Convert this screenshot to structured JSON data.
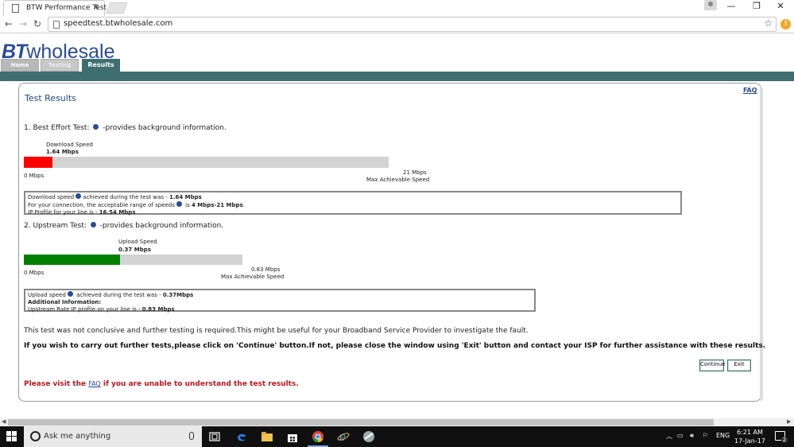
{
  "browser": {
    "tab_title": "BTW Performance Test",
    "tab_close": "✕",
    "url": "speedtest.btwholesale.com",
    "back": "←",
    "forward": "→",
    "reload": "↻",
    "star": "☆",
    "minimize": "—",
    "maximize": "❐",
    "close": "✕"
  },
  "header": {
    "logo_bt": "BT",
    "logo_wholesale": "wholesale",
    "tabs": [
      {
        "label": "Home"
      },
      {
        "label": "Testing"
      },
      {
        "label": "Results"
      }
    ]
  },
  "page": {
    "faq_link": "FAQ",
    "title": "Test Results",
    "best_effort": {
      "heading_prefix": "1. Best Effort Test:",
      "heading_suffix": "-provides background information.",
      "bar_label": "Download  Speed",
      "bar_value": "1.64 Mbps",
      "bar_fraction": 0.078,
      "bar_color": "#ff0000",
      "min_label": "0 Mbps",
      "max_value": "21 Mbps",
      "max_label": "Max Achievable Speed",
      "info_line1_prefix": "Download speed",
      "info_line1_mid": "achieved during the test was - ",
      "info_line1_value": "1.64 Mbps",
      "info_line2_prefix": "For your connection, the acceptable range of speeds",
      "info_line2_mid": " is ",
      "info_line2_value": "4 Mbps-21 Mbps",
      "info_line2_suffix": ".",
      "info_line3_prefix": "IP Profile for your line is - ",
      "info_line3_value": "16.54 Mbps"
    },
    "upstream": {
      "heading_prefix": "2. Upstream Test:",
      "heading_suffix": "-provides background information.",
      "bar_label": "Upload Speed",
      "bar_value": "0.37 Mbps",
      "bar_fraction": 0.44,
      "bar_color": "#008000",
      "min_label": "0 Mbps",
      "max_value": "0.83 Mbps",
      "max_label": "Max Achievable Speed",
      "info_line1_prefix": "Upload speed",
      "info_line1_mid": " achieved during the test was - ",
      "info_line1_value": "0.37Mbps",
      "info_line2": "Additional Information:",
      "info_line3_prefix": "Upstream Rate IP profile on your line is - ",
      "info_line3_value": "0.83 Mbps"
    },
    "note": "This test was not conclusive and further testing is required.This might be useful for your Broadband Service Provider to investigate the fault.",
    "instruction": "If you wish to carry out further tests,please click on 'Continue' button.If not, please close the window using 'Exit' button and contact your ISP for further assistance with these results.",
    "continue_button": "Continue",
    "exit_button": "Exit",
    "visit_prefix": "Please visit the ",
    "visit_link": "FAQ",
    "visit_suffix": " if you are unable to understand the test results."
  },
  "taskbar": {
    "search_placeholder": "Ask me anything",
    "tray_lang": "ENG",
    "time": "6:21 AM",
    "date": "17-Jan-17",
    "notif_count": "2"
  }
}
